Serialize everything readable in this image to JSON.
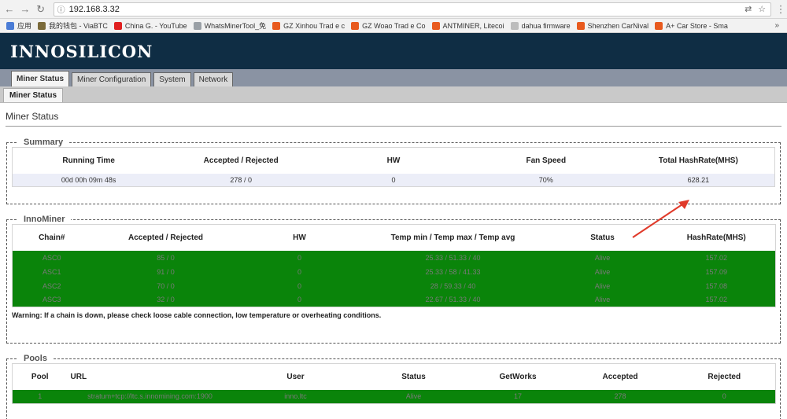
{
  "browser": {
    "url": "192.168.3.32",
    "bookmarks": [
      {
        "label": "应用",
        "color": "#4a7cd6"
      },
      {
        "label": "我的钱包 - ViaBTC",
        "color": "#7a6a3a"
      },
      {
        "label": "China G. - YouTube",
        "color": "#e02020"
      },
      {
        "label": "WhatsMinerTool_免",
        "color": "#9aa0a6"
      },
      {
        "label": "GZ Xinhou Trad e c",
        "color": "#e85a1e"
      },
      {
        "label": "GZ Woao Trad e Co",
        "color": "#e85a1e"
      },
      {
        "label": "ANTMINER, Litecoi",
        "color": "#e85a1e"
      },
      {
        "label": "dahua firmware",
        "color": "#bdbdbd"
      },
      {
        "label": "Shenzhen CarNival",
        "color": "#e85a1e"
      },
      {
        "label": "A+ Car Store - Sma",
        "color": "#e85a1e"
      }
    ],
    "bookmarks_more": "»"
  },
  "app": {
    "logo": "INNOSILICON",
    "tabs": [
      "Miner Status",
      "Miner Configuration",
      "System",
      "Network"
    ],
    "subtab": "Miner Status",
    "page_title": "Miner Status"
  },
  "summary": {
    "legend": "Summary",
    "headers": [
      "Running Time",
      "Accepted / Rejected",
      "HW",
      "Fan Speed",
      "Total HashRate(MHS)"
    ],
    "row": [
      "00d 00h 09m 48s",
      "278 / 0",
      "0",
      "70%",
      "628.21"
    ]
  },
  "innominer": {
    "legend": "InnoMiner",
    "headers": [
      "Chain#",
      "Accepted / Rejected",
      "HW",
      "Temp min / Temp max / Temp avg",
      "Status",
      "HashRate(MHS)"
    ],
    "rows": [
      [
        "ASC0",
        "85 / 0",
        "0",
        "25.33 / 51.33 / 40",
        "Alive",
        "157.02"
      ],
      [
        "ASC1",
        "91 / 0",
        "0",
        "25.33 / 58 / 41.33",
        "Alive",
        "157.09"
      ],
      [
        "ASC2",
        "70 / 0",
        "0",
        "28 / 59.33 / 40",
        "Alive",
        "157.08"
      ],
      [
        "ASC3",
        "32 / 0",
        "0",
        "22.67 / 51.33 / 40",
        "Alive",
        "157.02"
      ]
    ],
    "warning": "Warning: If a chain is down, please check loose cable connection, low temperature or overheating conditions."
  },
  "pools": {
    "legend": "Pools",
    "headers": [
      "Pool",
      "URL",
      "User",
      "Status",
      "GetWorks",
      "Accepted",
      "Rejected"
    ],
    "rows": [
      [
        "1",
        "stratum+tcp://ltc.s.innomining.com:1900",
        "inno.ltc",
        "Alive",
        "17",
        "278",
        "0"
      ]
    ]
  },
  "colors": {
    "header_bg": "#0f2d44",
    "chain_row_bg": "#0a840a",
    "annotation_arrow": "#e03a2a"
  }
}
